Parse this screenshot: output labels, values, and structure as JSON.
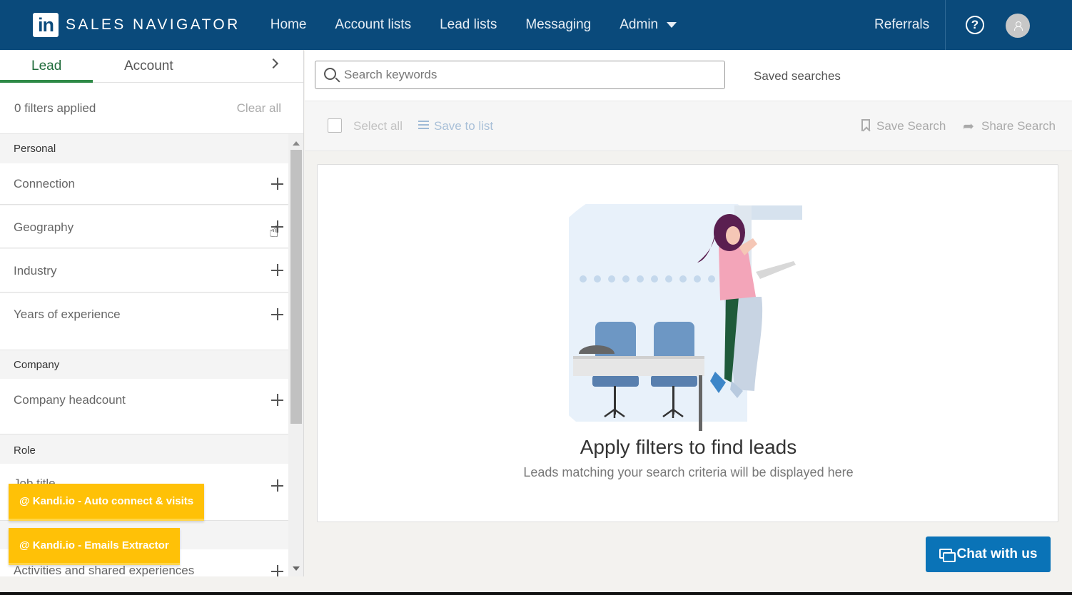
{
  "nav": {
    "logo_text": "in",
    "brand": "SALES NAVIGATOR",
    "links": [
      "Home",
      "Account lists",
      "Lead lists",
      "Messaging"
    ],
    "admin": "Admin",
    "referrals": "Referrals",
    "help_symbol": "?",
    "brand_color": "#0a4a7b"
  },
  "left": {
    "tab_lead": "Lead",
    "tab_account": "Account",
    "filters_applied": "0 filters applied",
    "clear_all": "Clear all",
    "section_personal": "Personal",
    "section_company": "Company",
    "section_role": "Role",
    "filters": {
      "connection": "Connection",
      "geography": "Geography",
      "industry": "Industry",
      "years": "Years of experience",
      "headcount": "Company headcount",
      "job_title": "Job title",
      "activities": "Activities and shared experiences"
    }
  },
  "kandi": {
    "auto_connect": "@ Kandi.io - Auto connect & visits",
    "emails": "@ Kandi.io - Emails Extractor",
    "color": "#ffc107"
  },
  "main": {
    "search_placeholder": "Search keywords",
    "saved_searches": "Saved searches",
    "select_all": "Select all",
    "save_to_list": "Save to list",
    "save_search": "Save Search",
    "share_search": "Share Search",
    "empty_title": "Apply filters to find leads",
    "empty_subtitle": "Leads matching your search criteria will be displayed here",
    "chat": "Chat with us",
    "accent": "#2e8a47"
  }
}
